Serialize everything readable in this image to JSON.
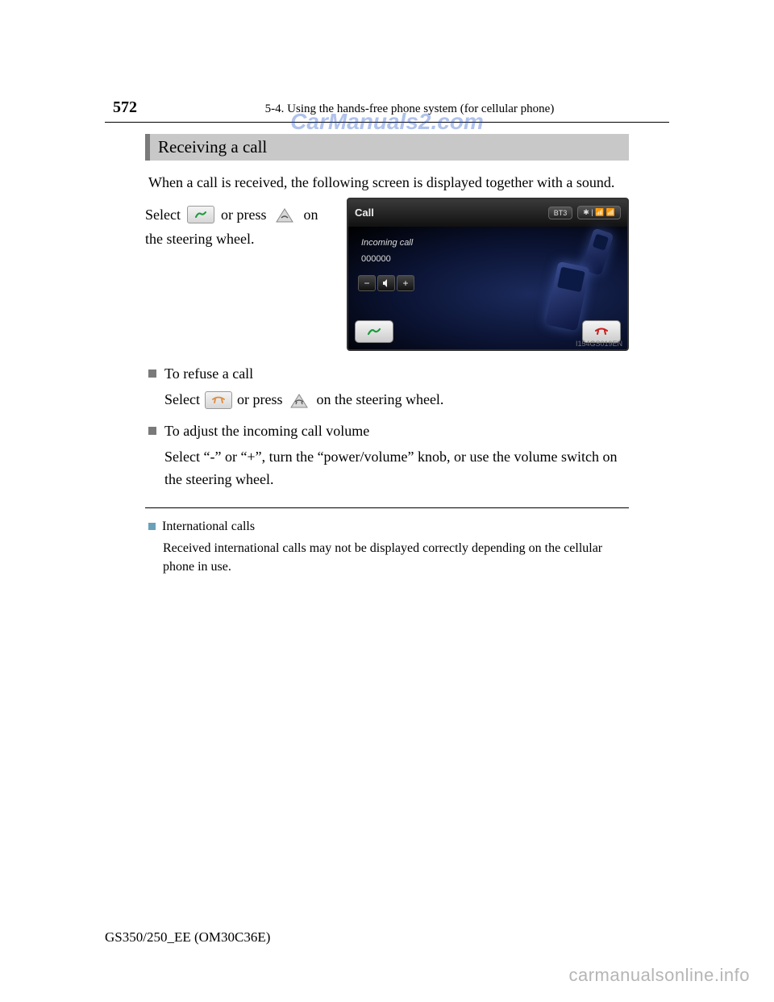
{
  "watermark": {
    "top": "CarManuals2.com",
    "bottom": "carmanualsonline.info"
  },
  "header": {
    "page_number": "572",
    "chapter": "5-4. Using the hands-free phone system (for cellular phone)"
  },
  "section_heading": "Receiving a call",
  "intro": "When a call is received, the following screen is displayed together with a sound.",
  "select_line": {
    "part1": "Select",
    "part2": "or press",
    "part3": "on",
    "part4": "the steering wheel."
  },
  "screenshot": {
    "title": "Call",
    "chip1": "BT3",
    "chip2": "✱ | 📶  📶",
    "incoming": "Incoming call",
    "number": "000000",
    "code": "I154GS019EN"
  },
  "sub_items": [
    {
      "title": "To refuse a call",
      "body_parts": [
        "Select",
        "or press",
        "on the steering wheel."
      ]
    },
    {
      "title": "To adjust the incoming call volume",
      "body_plain": "Select “-” or “+”, turn the “power/volume” knob, or use the volume switch on the steering wheel."
    }
  ],
  "note": {
    "title": "International calls",
    "body": "Received international calls may not be displayed correctly depending on the cellular phone in use."
  },
  "footer": "GS350/250_EE (OM30C36E)"
}
